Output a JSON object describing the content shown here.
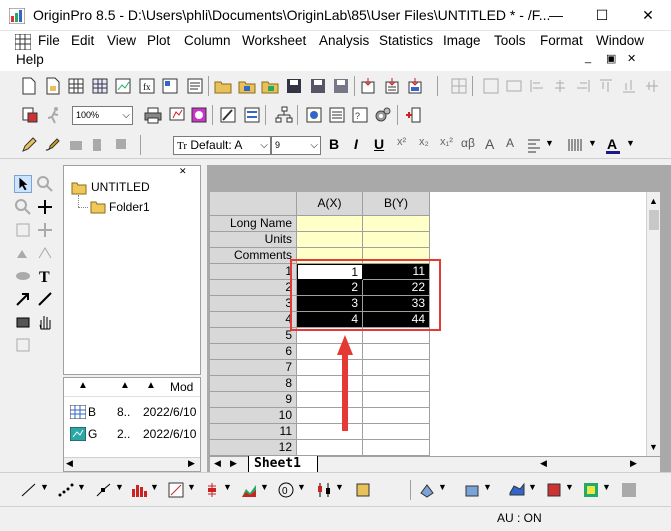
{
  "window": {
    "title": "OriginPro 8.5 - D:\\Users\\phli\\Documents\\OriginLab\\85\\User Files\\UNTITLED * - /F...",
    "minimize": "—",
    "maximize": "☐",
    "close": "✕"
  },
  "menu": [
    "File",
    "Edit",
    "View",
    "Plot",
    "Column",
    "Worksheet",
    "Analysis",
    "Statistics",
    "Image",
    "Tools",
    "Format",
    "Window",
    "Help"
  ],
  "toolbar": {
    "zoom_value": "100%",
    "font_name": "Default: A",
    "font_size": "9",
    "font_name_prefix": "Tr"
  },
  "format_buttons": [
    "B",
    "I",
    "U",
    "x²",
    "x₂",
    "x₁²",
    "αβ",
    "A",
    "A"
  ],
  "project_explorer": {
    "root": "UNTITLED",
    "folder": "Folder1",
    "list_header_mod": "Mod",
    "items": [
      {
        "name": "B",
        "size": "8..",
        "modified": "2022/6/10"
      },
      {
        "name": "G",
        "size": "2..",
        "modified": "2022/6/10"
      }
    ]
  },
  "worksheet": {
    "columns": [
      "A(X)",
      "B(Y)"
    ],
    "meta_rows": [
      "Long Name",
      "Units",
      "Comments"
    ],
    "row_numbers": [
      "1",
      "2",
      "3",
      "4",
      "5",
      "6",
      "7",
      "8",
      "9",
      "10",
      "11",
      "12"
    ],
    "data": [
      [
        "1",
        "11"
      ],
      [
        "2",
        "22"
      ],
      [
        "3",
        "33"
      ],
      [
        "4",
        "44"
      ]
    ],
    "sheet_tab": "Sheet1"
  },
  "status": {
    "au": "AU : ON"
  },
  "colors": {
    "highlight": "#e53935",
    "meta_fill": "#ffffc8",
    "selection": "#000000"
  }
}
